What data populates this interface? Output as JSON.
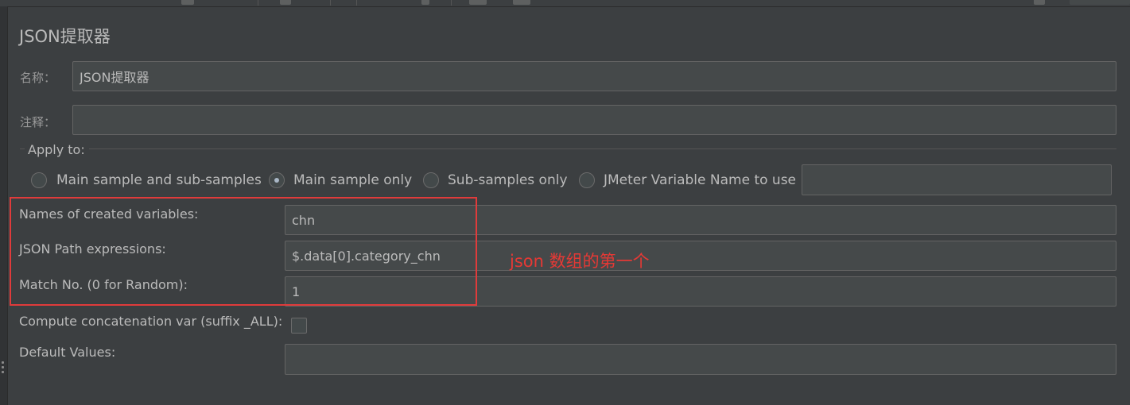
{
  "panel": {
    "title": "JSON提取器"
  },
  "form": {
    "name_label": "名称：",
    "name_value": "JSON提取器",
    "comment_label": "注释：",
    "comment_value": ""
  },
  "apply_to": {
    "legend": "Apply to:",
    "options": [
      {
        "label": "Main sample and sub-samples",
        "checked": false
      },
      {
        "label": "Main sample only",
        "checked": true
      },
      {
        "label": "Sub-samples only",
        "checked": false
      },
      {
        "label": "JMeter Variable Name to use",
        "checked": false
      }
    ],
    "variable_name_value": ""
  },
  "extractor": {
    "names_label": "Names of created variables:",
    "names_value": "chn",
    "path_label": "JSON Path expressions:",
    "path_value": "$.data[0].category_chn",
    "match_label": "Match No. (0 for Random):",
    "match_value": "1",
    "concat_label": "Compute concatenation var (suffix _ALL):",
    "concat_checked": false,
    "default_label": "Default Values:",
    "default_value": ""
  },
  "annotation": {
    "text": "json 数组的第一个",
    "color": "#e53935"
  },
  "colors": {
    "background": "#3c3f41",
    "field": "#45494a",
    "text": "#bbbbbb",
    "highlight": "#e03b3b"
  }
}
